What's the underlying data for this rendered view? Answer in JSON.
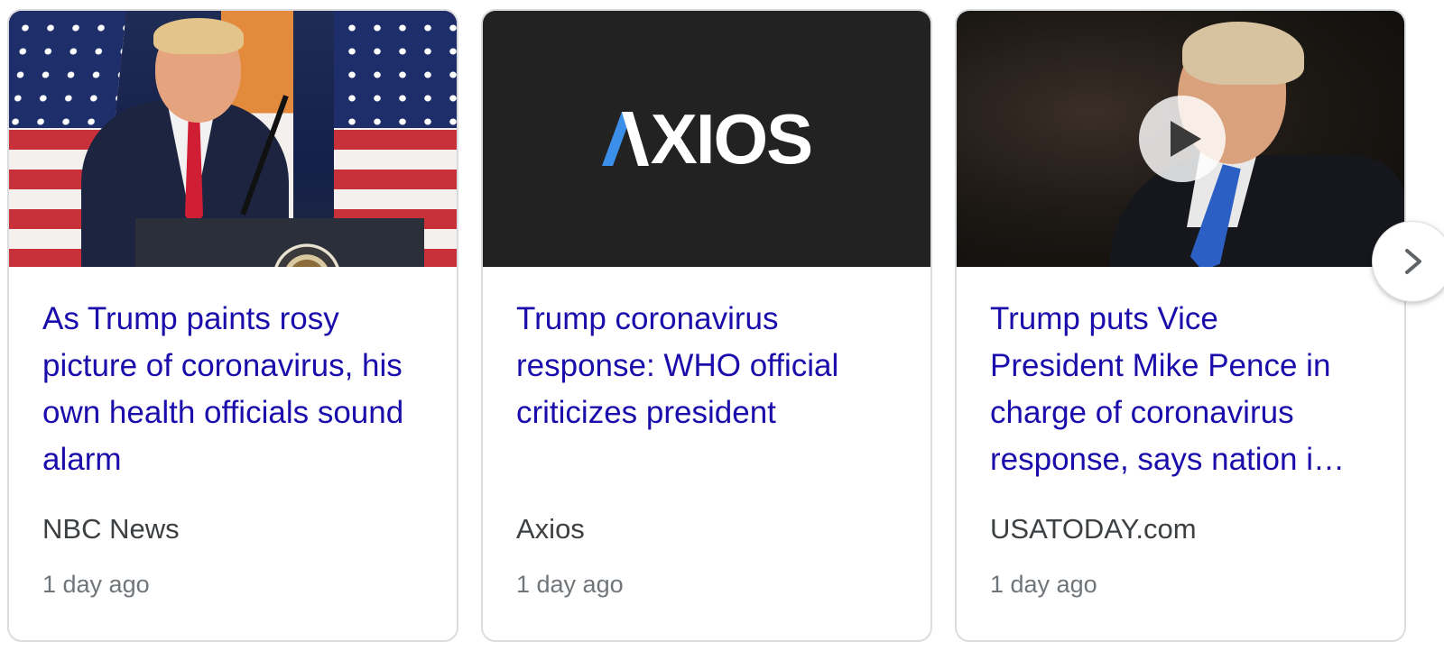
{
  "cards": [
    {
      "headline": "As Trump paints rosy picture of coronavirus, his own health officials sound alarm",
      "source": "NBC News",
      "time": "1 day ago",
      "thumbnail": "photo"
    },
    {
      "headline": "Trump coronavirus response: WHO official criticizes president",
      "source": "Axios",
      "time": "1 day ago",
      "thumbnail": "logo",
      "logo_text": "XIOS"
    },
    {
      "headline_lines": [
        "Trump puts Vice",
        "President Mike Pence in",
        "charge of coronavirus",
        "response, says nation i…"
      ],
      "source": "USATODAY.com",
      "time": "1 day ago",
      "thumbnail": "video"
    }
  ],
  "colors": {
    "headline": "#1a0dab",
    "source": "#3c4043",
    "time": "#70757a",
    "axios_accent": "#3b8fe8"
  },
  "icons": {
    "play": "play-icon",
    "next": "chevron-right-icon"
  }
}
